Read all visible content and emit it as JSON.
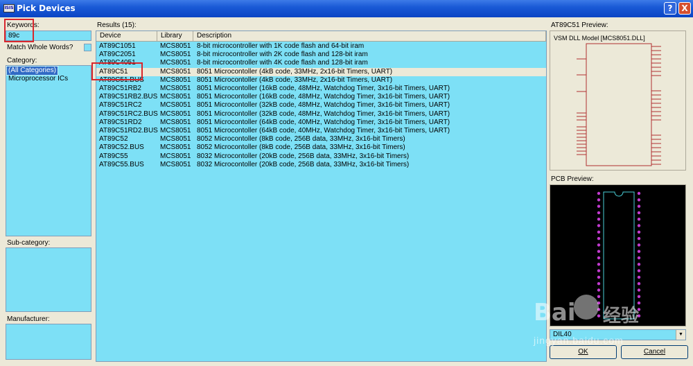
{
  "window": {
    "title": "Pick Devices",
    "app_icon_text": "ISIS",
    "help_glyph": "?",
    "close_glyph": "X"
  },
  "left": {
    "keywords_label": "Keywords:",
    "keywords_value": "89c",
    "match_whole_label": "Match Whole Words?",
    "category_label": "Category:",
    "categories": [
      {
        "label": "(All Categories)",
        "selected": true
      },
      {
        "label": "Microprocessor ICs",
        "selected": false
      }
    ],
    "subcategory_label": "Sub-category:",
    "manufacturer_label": "Manufacturer:"
  },
  "results": {
    "label": "Results (15):",
    "columns": [
      "Device",
      "Library",
      "Description"
    ],
    "rows": [
      {
        "device": "AT89C1051",
        "library": "MCS8051",
        "description": "8-bit microcontroller with 1K code flash and 64-bit iram"
      },
      {
        "device": "AT89C2051",
        "library": "MCS8051",
        "description": "8-bit microcontroller with 2K code flash and 128-bit iram"
      },
      {
        "device": "AT89C4051",
        "library": "MCS8051",
        "description": "8-bit microcontroller with 4K code flash and 128-bit iram"
      },
      {
        "device": "AT89C51",
        "library": "MCS8051",
        "description": "8051 Microcontoller (4kB code, 33MHz, 2x16-bit Timers, UART)",
        "selected": true
      },
      {
        "device": "AT89C51.BUS",
        "library": "MCS8051",
        "description": "8051 Microcontoller (4kB code, 33MHz, 2x16-bit Timers, UART)"
      },
      {
        "device": "AT89C51RB2",
        "library": "MCS8051",
        "description": "8051 Microcontoller (16kB code, 48MHz, Watchdog Timer, 3x16-bit Timers, UART)"
      },
      {
        "device": "AT89C51RB2.BUS",
        "library": "MCS8051",
        "description": "8051 Microcontoller (16kB code, 48MHz, Watchdog Timer, 3x16-bit Timers, UART)"
      },
      {
        "device": "AT89C51RC2",
        "library": "MCS8051",
        "description": "8051 Microcontoller (32kB code, 48MHz, Watchdog Timer, 3x16-bit Timers, UART)"
      },
      {
        "device": "AT89C51RC2.BUS",
        "library": "MCS8051",
        "description": "8051 Microcontoller (32kB code, 48MHz, Watchdog Timer, 3x16-bit Timers, UART)"
      },
      {
        "device": "AT89C51RD2",
        "library": "MCS8051",
        "description": "8051 Microcontoller (64kB code, 40MHz, Watchdog Timer, 3x16-bit Timers, UART)"
      },
      {
        "device": "AT89C51RD2.BUS",
        "library": "MCS8051",
        "description": "8051 Microcontoller (64kB code, 40MHz, Watchdog Timer, 3x16-bit Timers, UART)"
      },
      {
        "device": "AT89C52",
        "library": "MCS8051",
        "description": "8052 Microcontoller (8kB code, 256B data, 33MHz, 3x16-bit Timers)"
      },
      {
        "device": "AT89C52.BUS",
        "library": "MCS8051",
        "description": "8052 Microcontoller (8kB code, 256B data, 33MHz, 3x16-bit Timers)"
      },
      {
        "device": "AT89C55",
        "library": "MCS8051",
        "description": "8032 Microcontoller (20kB code, 256B data, 33MHz, 3x16-bit Timers)"
      },
      {
        "device": "AT89C55.BUS",
        "library": "MCS8051",
        "description": "8032 Microcontoller (20kB code, 256B data, 33MHz, 3x16-bit Timers)"
      }
    ]
  },
  "preview": {
    "label": "AT89C51 Preview:",
    "model_text": "VSM DLL Model [MCS8051.DLL]",
    "pcb_label": "PCB Preview:",
    "package_value": "DIL40"
  },
  "buttons": {
    "ok": "OK",
    "cancel": "Cancel"
  },
  "watermark": {
    "brand": "Bai",
    "cn": "经验",
    "url": "jingyan.baidu.com"
  },
  "colors": {
    "list_bg": "#7de0f6",
    "title_bar": "#0b44c4",
    "selection": "#316ac5",
    "highlight_box": "#d8262c"
  }
}
